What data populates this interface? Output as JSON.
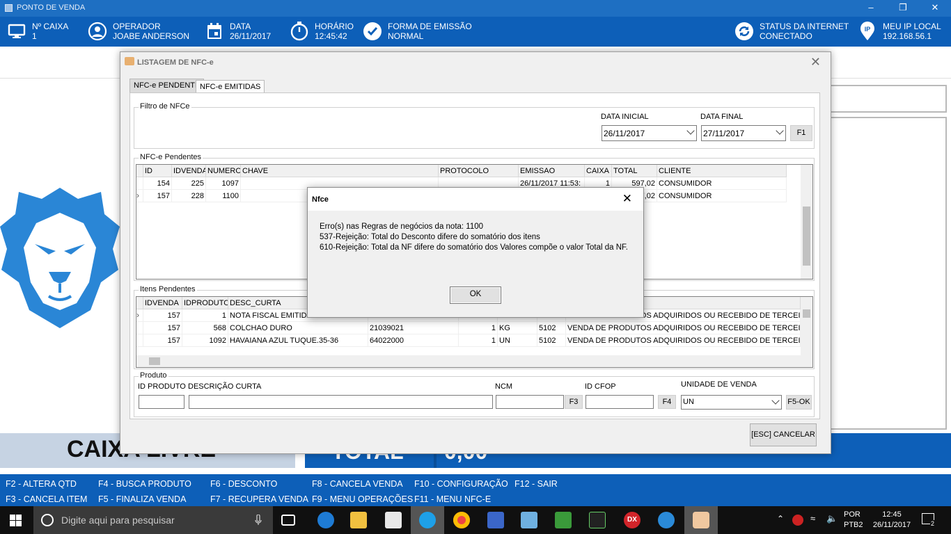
{
  "window": {
    "title": "PONTO DE VENDA"
  },
  "header": [
    {
      "icon": "monitor-icon",
      "label": "Nº CAIXA",
      "value": "1"
    },
    {
      "icon": "user-icon",
      "label": "OPERADOR",
      "value": "JOABE ANDERSON"
    },
    {
      "icon": "calendar-icon",
      "label": "DATA",
      "value": "26/11/2017"
    },
    {
      "icon": "stopwatch-icon",
      "label": "HORÁRIO",
      "value": "12:45:42"
    },
    {
      "icon": "check-circle-icon",
      "label": "FORMA DE EMISSÃO",
      "value": "NORMAL"
    },
    {
      "icon": "sync-icon",
      "label": "STATUS DA INTERNET",
      "value": "CONECTADO"
    },
    {
      "icon": "ip-pin-icon",
      "icon_text": "IP",
      "label": "MEU IP LOCAL",
      "value": "192.168.56.1"
    }
  ],
  "main": {
    "caixa_livre": "CAIXA LIVRE",
    "total_label": "TOTAL",
    "total_value": "0,00"
  },
  "fkeys": [
    "F2 - ALTERA QTD",
    "F4 - BUSCA PRODUTO",
    "F6 - DESCONTO",
    "F8 - CANCELA VENDA",
    "F10 - CONFIGURAÇÃO",
    "F12 - SAIR",
    "F3 - CANCELA ITEM",
    "F5 - FINALIZA VENDA",
    "F7 - RECUPERA VENDA",
    "F9 - MENU OPERAÇÕES",
    "F11 - MENU NFC-E"
  ],
  "dialog": {
    "title": "LISTAGEM DE NFC-e",
    "tabs": [
      "NFC-e PENDENTE",
      "NFC-e EMITIDAS"
    ],
    "filter": {
      "legend": "Filtro de NFCe",
      "data_inicial_label": "DATA INICIAL",
      "data_inicial": "26/11/2017",
      "data_final_label": "DATA FINAL",
      "data_final": "27/11/2017",
      "button": "F1"
    },
    "pendentes": {
      "legend": "NFC-e Pendentes",
      "columns": [
        "ID",
        "IDVENDA",
        "NUMERO",
        "CHAVE",
        "PROTOCOLO",
        "EMISSAO",
        "CAIXA",
        "TOTAL",
        "CLIENTE"
      ],
      "rows": [
        [
          "154",
          "225",
          "1097",
          "",
          "",
          "26/11/2017 11:53:",
          "1",
          "597,02",
          "CONSUMIDOR"
        ],
        [
          "157",
          "228",
          "1100",
          "",
          "",
          "",
          "",
          "597,02",
          "CONSUMIDOR"
        ]
      ]
    },
    "itens": {
      "legend": "Itens Pendentes",
      "columns": [
        "IDVENDA",
        "IDPRODUTO",
        "DESC_CURTA"
      ],
      "rows": [
        [
          "157",
          "1",
          "NOTA FISCAL EMITIDA",
          "",
          "",
          "",
          "",
          "VENDA DE PRODUTOS ADQUIRIDOS OU RECEBIDO DE TERCEIROS"
        ],
        [
          "157",
          "568",
          "COLCHAO DURO",
          "21039021",
          "1",
          "KG",
          "5102",
          "VENDA DE PRODUTOS ADQUIRIDOS OU RECEBIDO DE TERCEIROS"
        ],
        [
          "157",
          "1092",
          "HAVAIANA AZUL TUQUE.35-36",
          "64022000",
          "1",
          "UN",
          "5102",
          "VENDA DE PRODUTOS ADQUIRIDOS OU RECEBIDO DE TERCEIROS"
        ]
      ]
    },
    "produto": {
      "legend": "Produto",
      "id_label": "ID PRODUTO",
      "desc_label": "DESCRIÇÃO CURTA",
      "ncm_label": "NCM",
      "ncm_btn": "F3",
      "cfop_label": "ID CFOP",
      "cfop_btn": "F4",
      "unidade_label": "UNIDADE DE VENDA",
      "unidade_value": "UN",
      "ok_btn": "F5-OK"
    },
    "cancel": "[ESC] CANCELAR"
  },
  "message": {
    "title": "Nfce",
    "lines": [
      "Erro(s) nas Regras de negócios da nota: 1100",
      "537-Rejeição: Total do Desconto difere do somatório dos itens",
      "610-Rejeição: Total da NF difere do somatório dos Valores compõe o valor Total da NF."
    ],
    "ok": "OK"
  },
  "taskbar": {
    "search_placeholder": "Digite aqui para pesquisar",
    "lang1": "POR",
    "lang2": "PTB2",
    "time": "12:45",
    "date": "26/11/2017",
    "notif_count": "2"
  }
}
